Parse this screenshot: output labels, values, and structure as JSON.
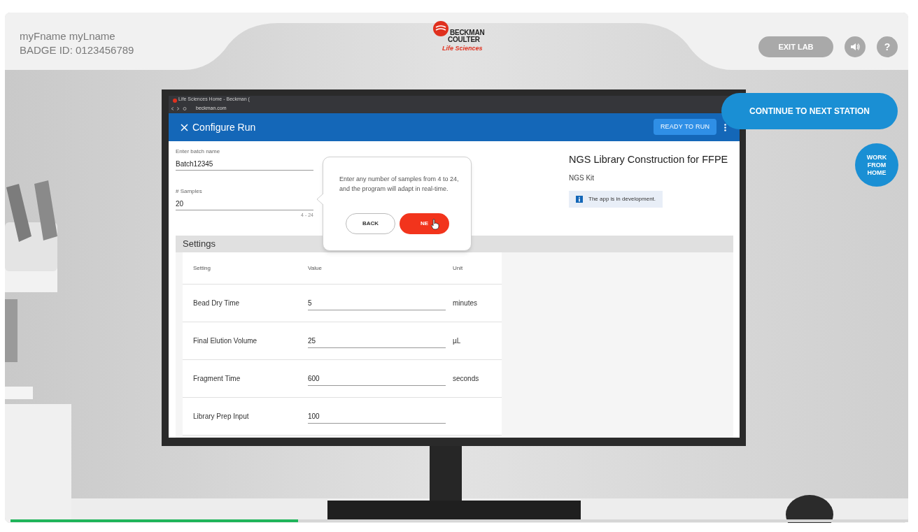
{
  "header": {
    "user_name": "myFname myLname",
    "badge": "BADGE ID: 0123456789",
    "logo": {
      "line_1": "BECKMAN",
      "line_2": "COULTER",
      "line_3": "Life Sciences"
    },
    "exit_button": "EXIT LAB",
    "help_button": "?"
  },
  "browser": {
    "tab_title": "Life Sciences Home - Beckman (",
    "url": "beckman.com"
  },
  "app": {
    "title": "Configure Run",
    "action": "READY TO RUN",
    "fields": [
      {
        "label": "Enter batch name",
        "value": "Batch12345"
      },
      {
        "label": "# Samples",
        "value": "20",
        "hint": "4 - 24"
      }
    ],
    "settings": {
      "title": "Settings",
      "columns": [
        "Setting",
        "Value",
        "Unit"
      ],
      "rows": [
        {
          "setting": "Bead Dry Time",
          "value": "5",
          "unit": "minutes"
        },
        {
          "setting": "Final Elution Volume",
          "value": "25",
          "unit": "µL"
        },
        {
          "setting": "Fragment Time",
          "value": "600",
          "unit": "seconds"
        },
        {
          "setting": "Library Prep Input",
          "value": "100"
        }
      ]
    },
    "kit": {
      "title": "NGS Library Construction for FFPE",
      "subtitle": "NGS Kit",
      "notice": "The app is in development."
    }
  },
  "tooltip": {
    "text": "Enter any number of samples from 4 to 24, and the program will adapt in real-time.",
    "buttons": [
      {
        "label": "BACK",
        "kind": "secondary"
      },
      {
        "label": "NE",
        "kind": "primary"
      }
    ]
  },
  "continue_button": "CONTINUE TO NEXT STATION",
  "work_from_home": "WORK FROM HOME",
  "progress": {
    "level": 0.32
  }
}
